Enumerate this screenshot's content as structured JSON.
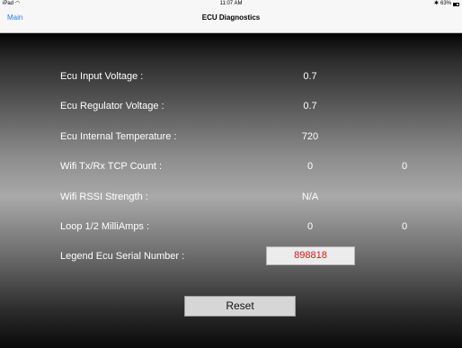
{
  "status_bar": {
    "device": "iPad",
    "wifi_icon": "wifi-icon",
    "time": "11:07 AM",
    "bluetooth_icon": "bluetooth-icon",
    "battery": "63%"
  },
  "nav": {
    "back_label": "Main",
    "title": "ECU Diagnostics",
    "back_color": "#2a7bf0"
  },
  "rows": [
    {
      "label": "Ecu Input Voltage :",
      "value": "0.7"
    },
    {
      "label": "Ecu Regulator Voltage :",
      "value": "0.7"
    },
    {
      "label": "Ecu Internal Temperature :",
      "value": "720"
    },
    {
      "label": "Wifi Tx/Rx TCP Count :",
      "value": "0",
      "value2": "0"
    },
    {
      "label": "Wifi RSSI Strength :",
      "value": "N/A"
    },
    {
      "label": "Loop 1/2 MilliAmps :",
      "value": "0",
      "value2": "0"
    },
    {
      "label": "Legend Ecu Serial Number :",
      "value": "898818"
    }
  ],
  "serial_color": "#e1141b",
  "reset_label": "Reset"
}
